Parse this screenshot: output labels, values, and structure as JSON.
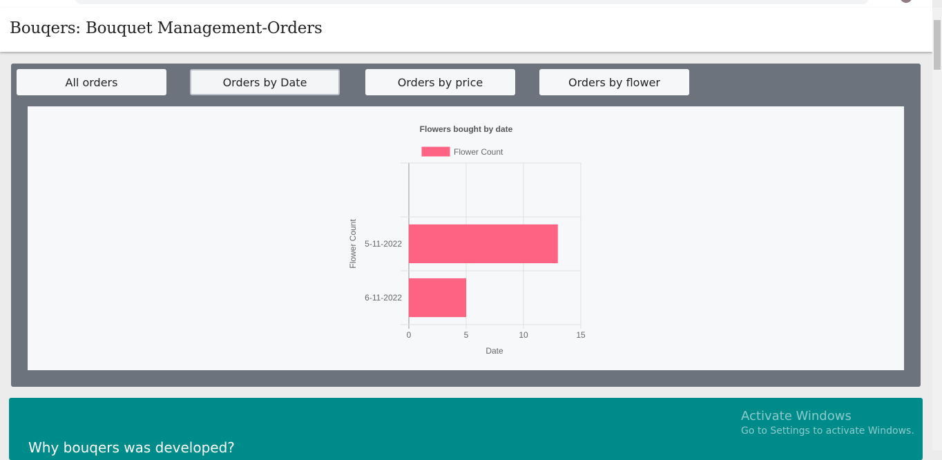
{
  "app": {
    "title": "Bouqers: Bouquet Management-Orders"
  },
  "tabs": [
    {
      "label": "All orders"
    },
    {
      "label": "Orders by Date"
    },
    {
      "label": "Orders by price"
    },
    {
      "label": "Orders by flower"
    }
  ],
  "active_tab": "Orders by Date",
  "chart_data": {
    "type": "bar",
    "orientation": "horizontal",
    "title": "Flowers bought by date",
    "categories": [
      "5-11-2022",
      "6-11-2022"
    ],
    "series": [
      {
        "name": "Flower Count",
        "values": [
          13,
          5
        ],
        "color": "#ff6384"
      }
    ],
    "xlabel": "Date",
    "ylabel": "Flower Count",
    "xlim": [
      0,
      15
    ],
    "xticks": [
      0,
      5,
      10,
      15
    ],
    "grid": true,
    "legend": "top"
  },
  "info": {
    "heading": "Why bouqers was developed?"
  },
  "watermark": {
    "line1": "Activate Windows",
    "line2": "Go to Settings to activate Windows."
  },
  "colors": {
    "panel": "#6c737d",
    "info": "#008b8b",
    "bar": "#ff6384"
  }
}
